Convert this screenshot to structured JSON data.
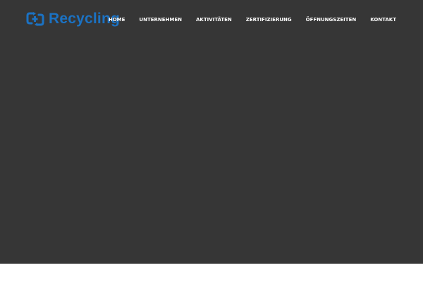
{
  "brand": {
    "name": "Recycling",
    "color": "#1b72c3",
    "icon": "recycle-logo-icon"
  },
  "nav": {
    "items": [
      {
        "label": "HOME"
      },
      {
        "label": "UNTERNEHMEN"
      },
      {
        "label": "AKTIVITÄTEN"
      },
      {
        "label": "ZERTIFIZIERUNG"
      },
      {
        "label": "ÖFFNUNGSZEITEN"
      },
      {
        "label": "KONTAKT"
      }
    ]
  },
  "colors": {
    "hero_background": "#363636",
    "nav_text": "#ffffff",
    "page_background": "#ffffff"
  }
}
